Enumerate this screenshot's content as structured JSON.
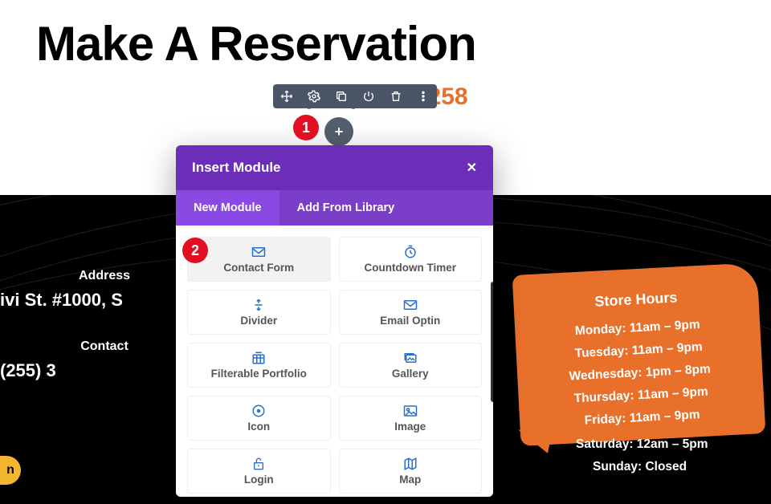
{
  "page": {
    "title": "Make A Reservation",
    "phone_display": "(255) 352-6258"
  },
  "left": {
    "address_label": "Address",
    "address_value": "ivi St. #1000, S",
    "contact_label": "Contact",
    "contact_value": "(255) 3"
  },
  "hours": {
    "title": "Store Hours",
    "lines": [
      "Monday: 11am – 9pm",
      "Tuesday: 11am – 9pm",
      "Wednesday: 1pm – 8pm",
      "Thursday: 11am – 9pm",
      "Friday: 11am – 9pm",
      "Saturday: 12am – 5pm",
      "Sunday: Closed"
    ]
  },
  "toolbar": {
    "icons": [
      "move-icon",
      "gear-icon",
      "duplicate-icon",
      "power-icon",
      "trash-icon",
      "more-icon"
    ]
  },
  "add_button": {
    "glyph": "+"
  },
  "annotations": {
    "one": "1",
    "two": "2"
  },
  "modal": {
    "title": "Insert Module",
    "close": "✕",
    "tabs": {
      "new": "New Module",
      "library": "Add From Library"
    },
    "items": [
      {
        "label": "Contact Form",
        "icon": "mail"
      },
      {
        "label": "Countdown Timer",
        "icon": "timer"
      },
      {
        "label": "Divider",
        "icon": "divider"
      },
      {
        "label": "Email Optin",
        "icon": "mail"
      },
      {
        "label": "Filterable Portfolio",
        "icon": "grid"
      },
      {
        "label": "Gallery",
        "icon": "image-multi"
      },
      {
        "label": "Icon",
        "icon": "circle-dot"
      },
      {
        "label": "Image",
        "icon": "image"
      },
      {
        "label": "Login",
        "icon": "lock"
      },
      {
        "label": "Map",
        "icon": "map"
      }
    ]
  },
  "chip": {
    "glyph": "n"
  }
}
